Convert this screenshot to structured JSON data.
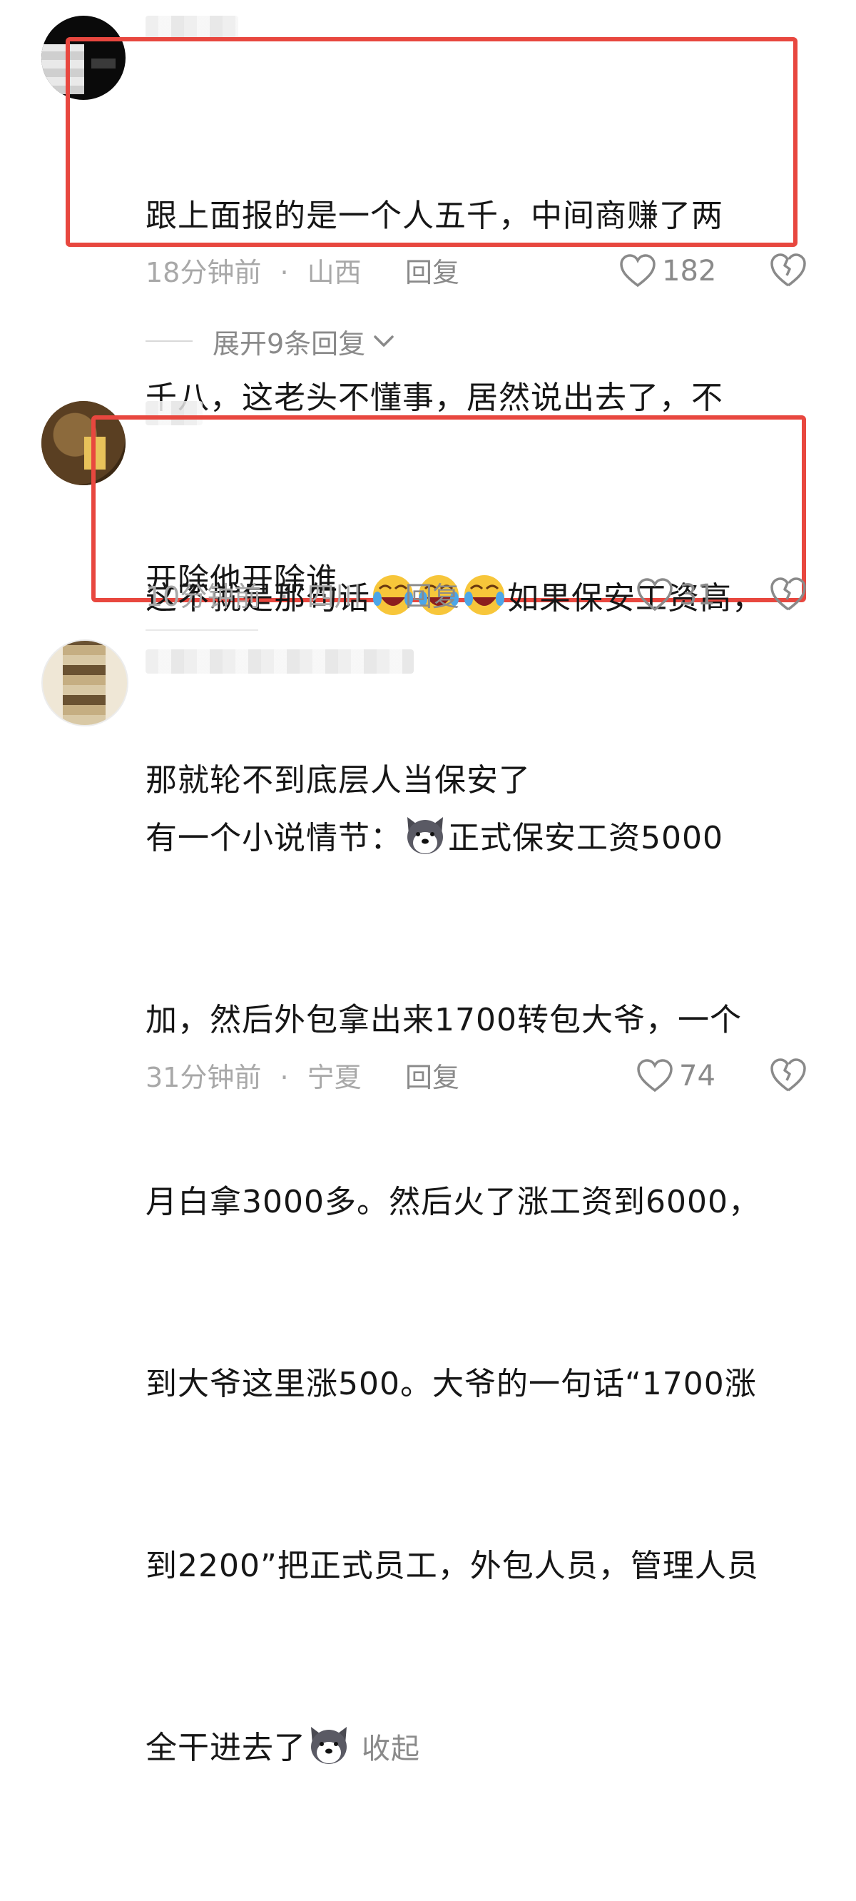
{
  "comments": [
    {
      "lines": [
        "跟上面报的是一个人五千，中间商赚了两",
        "千八，这老头不懂事，居然说出去了，不",
        "开除他开除谁"
      ],
      "time": "18分钟前",
      "separator": "·",
      "location": "山西",
      "reply_label": "回复",
      "likes": "182"
    },
    {
      "line1_before": "这不就是那句话",
      "line1_after": "如果保安工资高，",
      "line2": "那就轮不到底层人当保安了",
      "emoji": "laughing-crying-emoji",
      "time": "10分钟前",
      "separator": "·",
      "location": "四川",
      "reply_label": "回复",
      "likes": "31"
    },
    {
      "line1_before": "有一个小说情节：",
      "line1_after": "正式保安工资5000",
      "lines_middle": [
        "加，然后外包拿出来1700转包大爷，一个",
        "月白拿3000多。然后火了涨工资到6000，",
        "到大爷这里涨500。大爷的一句话“1700涨",
        "到2200”把正式员工，外包人员，管理人员"
      ],
      "last_line": "全干进去了",
      "emoji": "doge-emoji",
      "collapse_label": "收起",
      "time": "31分钟前",
      "separator": "·",
      "location": "宁夏",
      "reply_label": "回复",
      "likes": "74"
    }
  ],
  "expand_replies_label": "展开9条回复",
  "colors": {
    "highlight": "#e8473f",
    "meta_text": "#a8a8a8",
    "action_text": "#8a8a8a",
    "body_text": "#161616"
  }
}
